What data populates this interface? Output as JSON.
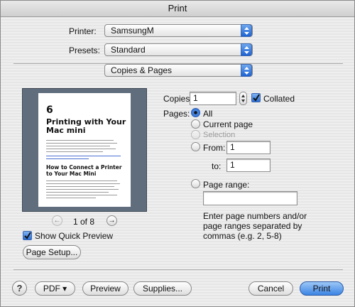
{
  "window": {
    "title": "Print"
  },
  "printer": {
    "label": "Printer:",
    "value": "SamsungM"
  },
  "presets": {
    "label": "Presets:",
    "value": "Standard"
  },
  "section": {
    "value": "Copies & Pages"
  },
  "preview": {
    "chapter_number": "6",
    "chapter_title": "Printing with Your Mac mini",
    "heading": "How to Connect a Printer to Your Mac Mini",
    "page_indicator": "1 of 8",
    "show_quick_preview_label": "Show Quick Preview",
    "show_quick_preview_checked": true
  },
  "copies": {
    "label": "Copies:",
    "value": "1",
    "collated_label": "Collated",
    "collated_checked": true
  },
  "pages": {
    "label": "Pages:",
    "options": {
      "all": "All",
      "current": "Current page",
      "selection": "Selection",
      "from": "From:",
      "to": "to:",
      "range": "Page range:"
    },
    "selected": "all",
    "from_value": "1",
    "to_value": "1",
    "range_value": "",
    "hint": "Enter page numbers and/or page ranges separated by commas (e.g. 2, 5-8)"
  },
  "buttons": {
    "page_setup": "Page Setup...",
    "help": "?",
    "pdf": "PDF ▾",
    "preview": "Preview",
    "supplies": "Supplies...",
    "cancel": "Cancel",
    "print": "Print"
  },
  "colors": {
    "accent": "#2a6fd6",
    "preview_bg": "#5f6d7c"
  }
}
